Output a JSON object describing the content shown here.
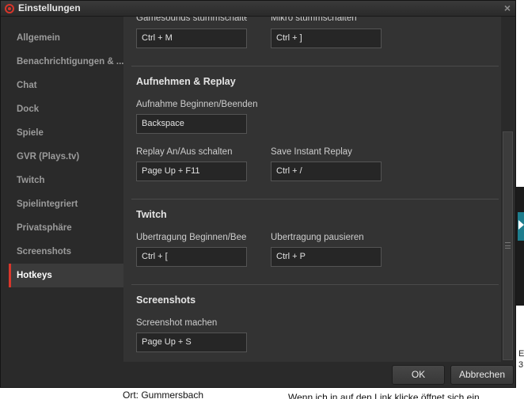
{
  "window": {
    "title": "Einstellungen",
    "close_symbol": "×"
  },
  "sidebar": {
    "items": [
      {
        "label": "Allgemein"
      },
      {
        "label": "Benachrichtigungen & ..."
      },
      {
        "label": "Chat"
      },
      {
        "label": "Dock"
      },
      {
        "label": "Spiele"
      },
      {
        "label": "GVR (Plays.tv)"
      },
      {
        "label": "Twitch"
      },
      {
        "label": "Spielintegriert"
      },
      {
        "label": "Privatsphäre"
      },
      {
        "label": "Screenshots"
      },
      {
        "label": "Hotkeys",
        "active": true
      }
    ]
  },
  "content": {
    "top_row": {
      "left_label": "Gamesounds stummschalten",
      "left_value": "Ctrl + M",
      "right_label": "Mikro stummschalten",
      "right_value": "Ctrl + ]"
    },
    "sections": [
      {
        "title": "Aufnehmen & Replay",
        "fields": [
          {
            "label": "Aufnahme Beginnen/Beenden",
            "value": "Backspace"
          },
          {
            "label": "Replay An/Aus schalten",
            "value": "Page Up + F11"
          },
          {
            "label": "Save Instant Replay",
            "value": "Ctrl + /"
          }
        ]
      },
      {
        "title": "Twitch",
        "fields": [
          {
            "label": "Übertragung Beginnen/Beenden",
            "value": "Ctrl + ["
          },
          {
            "label": "Übertragung pausieren",
            "value": "Ctrl + P"
          }
        ]
      },
      {
        "title": "Screenshots",
        "fields": [
          {
            "label": "Screenshot machen",
            "value": "Page Up + S"
          }
        ]
      }
    ]
  },
  "footer": {
    "ok_label": "OK",
    "cancel_label": "Abbrechen"
  },
  "background_page": {
    "bottom_left_text": "Ort: Gummersbach",
    "bottom_right_text": "Wenn ich in auf den Link klicke öffnet sich ein",
    "right_edge_text": "E\n3"
  },
  "colors": {
    "accent": "#d8362b",
    "window_bg": "#2c2c2c",
    "content_bg": "#333333",
    "field_bg": "#262626"
  },
  "icons": {
    "app_icon": "raptr-logo-icon",
    "close": "close-icon",
    "scroll_grip": "grip-icon"
  }
}
